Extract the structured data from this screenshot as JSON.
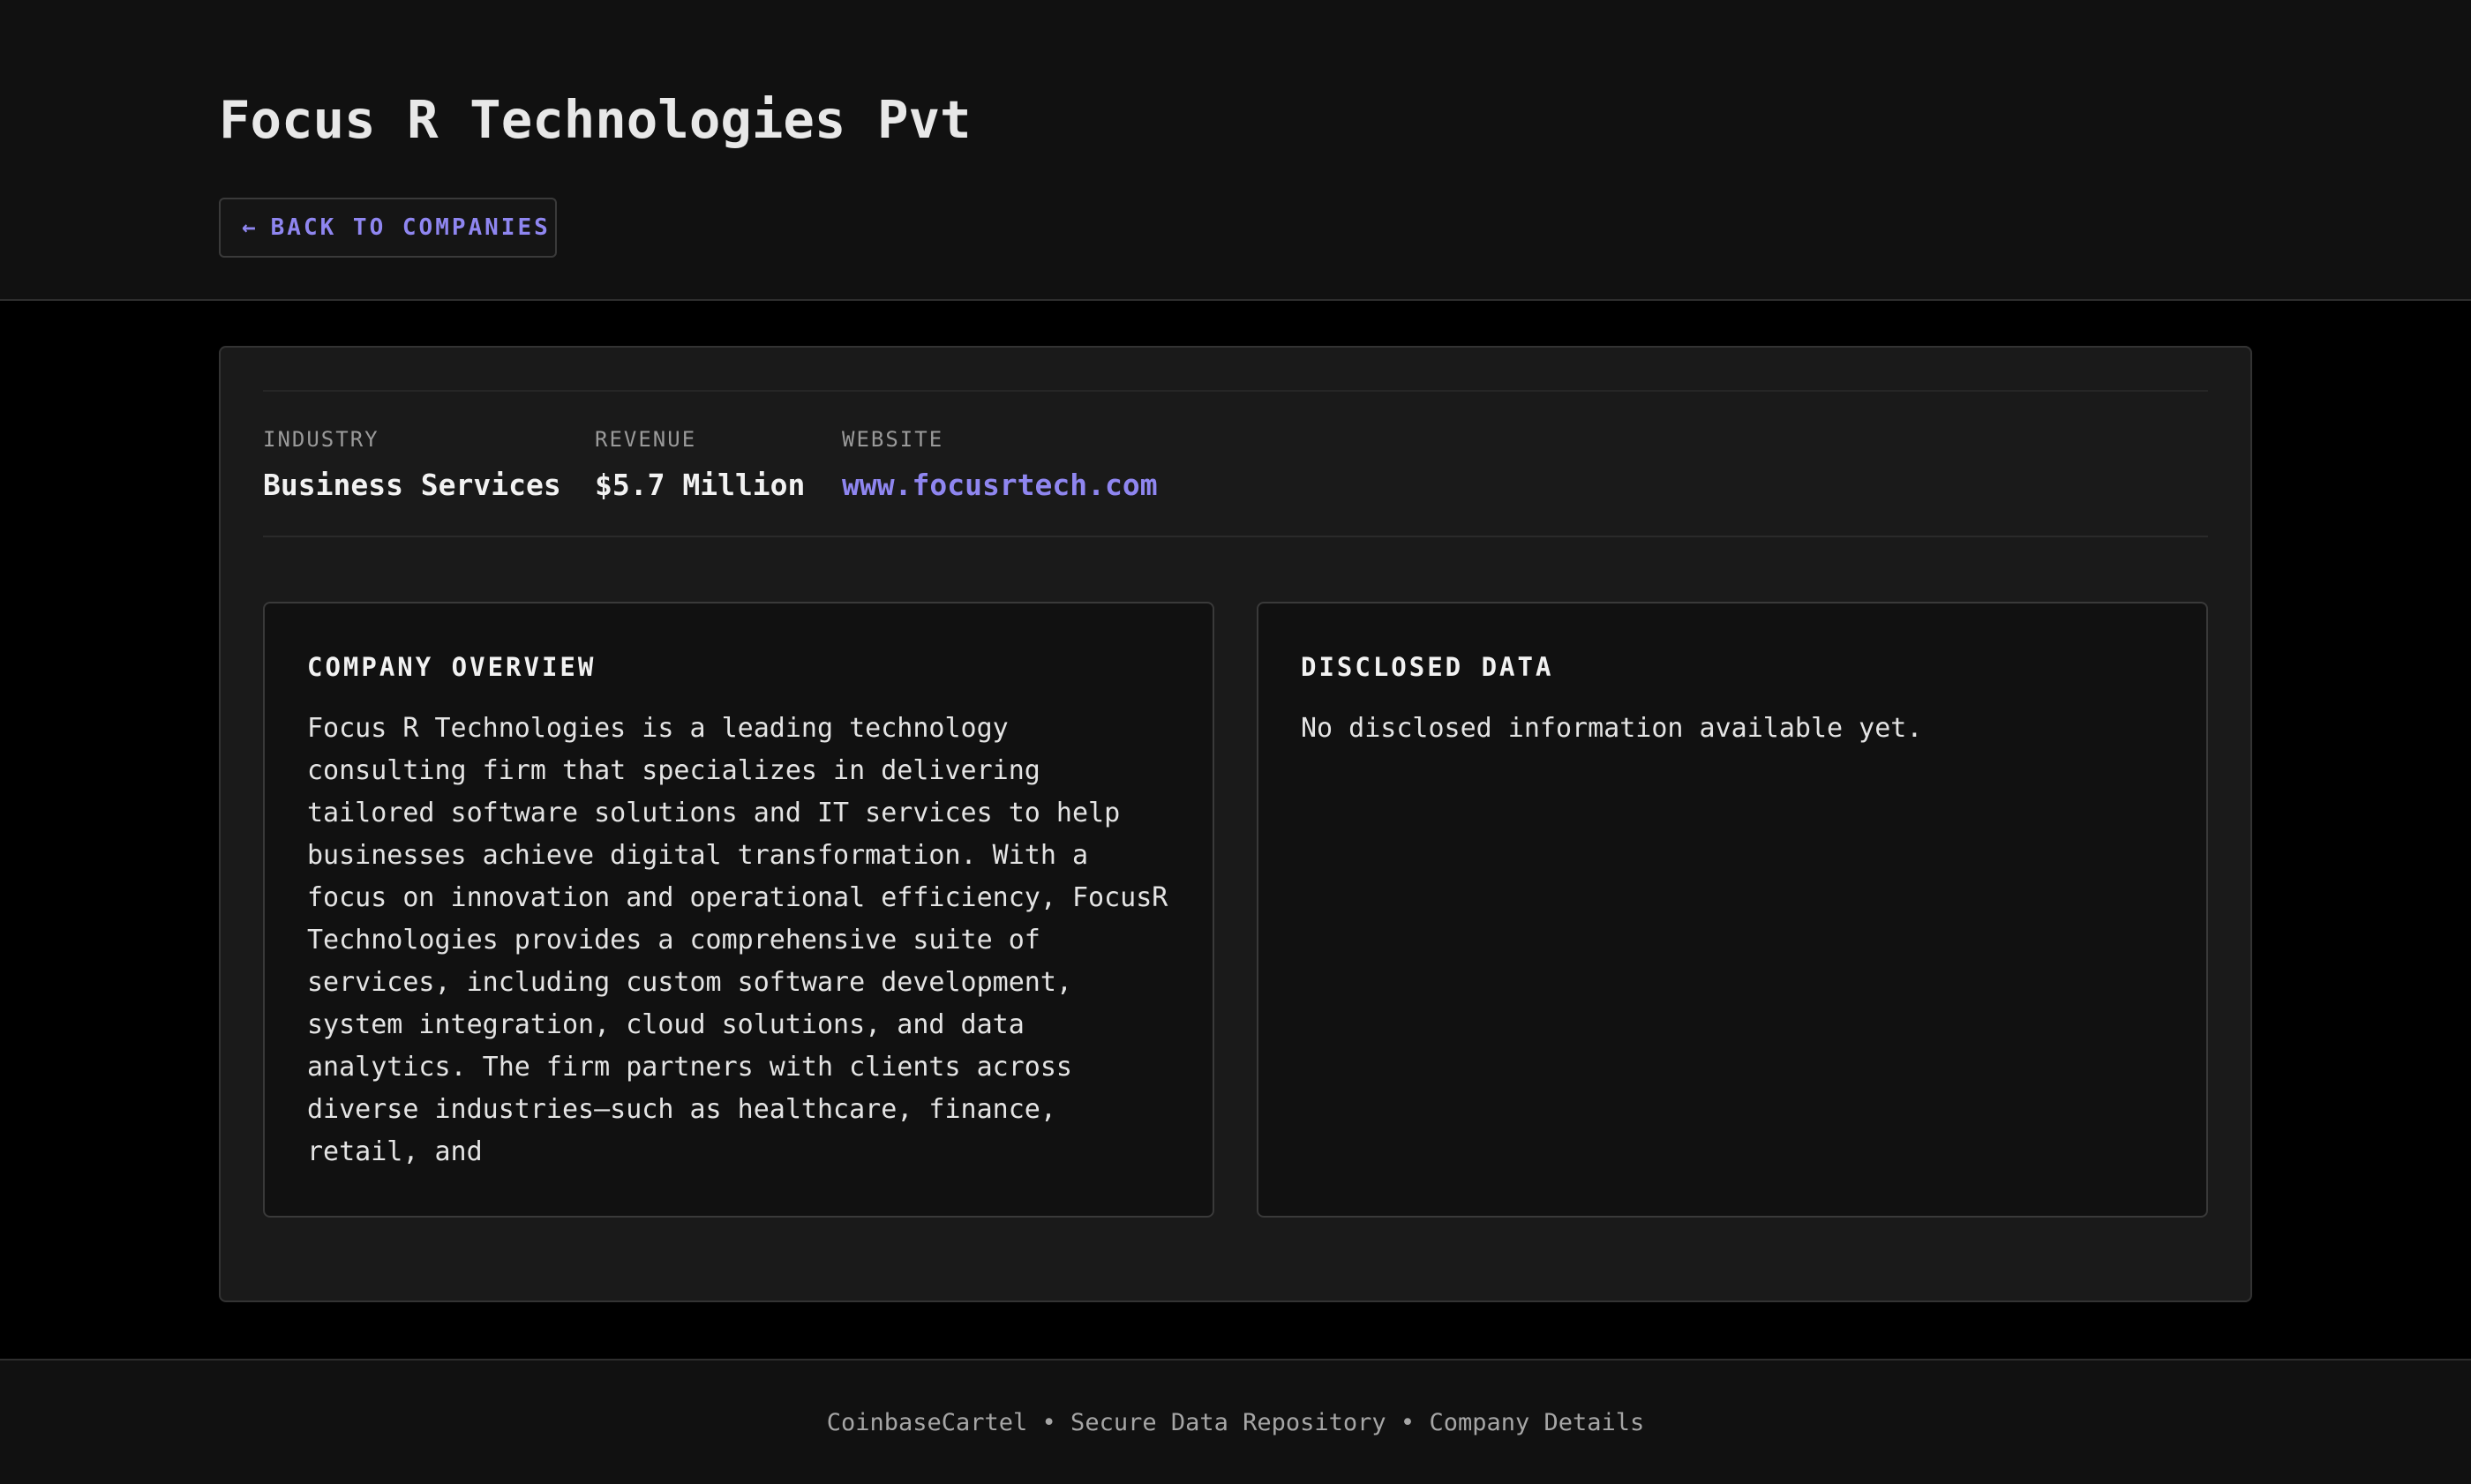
{
  "header": {
    "title": "Focus R Technologies Pvt",
    "back_button": {
      "arrow": "←",
      "label": "BACK TO COMPANIES"
    }
  },
  "stats": {
    "industry": {
      "label": "INDUSTRY",
      "value": "Business Services"
    },
    "revenue": {
      "label": "REVENUE",
      "value": "$5.7 Million"
    },
    "website": {
      "label": "WEBSITE",
      "value": "www.focusrtech.com"
    }
  },
  "overview": {
    "title": "COMPANY OVERVIEW",
    "text": "Focus R Technologies is a leading technology consulting firm that specializes in delivering tailored software solutions and IT services to help businesses achieve digital transformation. With a focus on innovation and operational efficiency, FocusR Technologies provides a comprehensive suite of services, including custom software development, system integration, cloud solutions, and data analytics. The firm partners with clients across diverse industries—such as healthcare, finance, retail, and"
  },
  "disclosed": {
    "title": "DISCLOSED DATA",
    "text": "No disclosed information available yet."
  },
  "footer": {
    "text": "CoinbaseCartel • Secure Data Repository • Company Details"
  },
  "colors": {
    "accent": "#8f86f0",
    "page_background": "#000000",
    "header_background": "#111111",
    "card_background": "#1a1a1a",
    "panel_background": "#111111"
  }
}
